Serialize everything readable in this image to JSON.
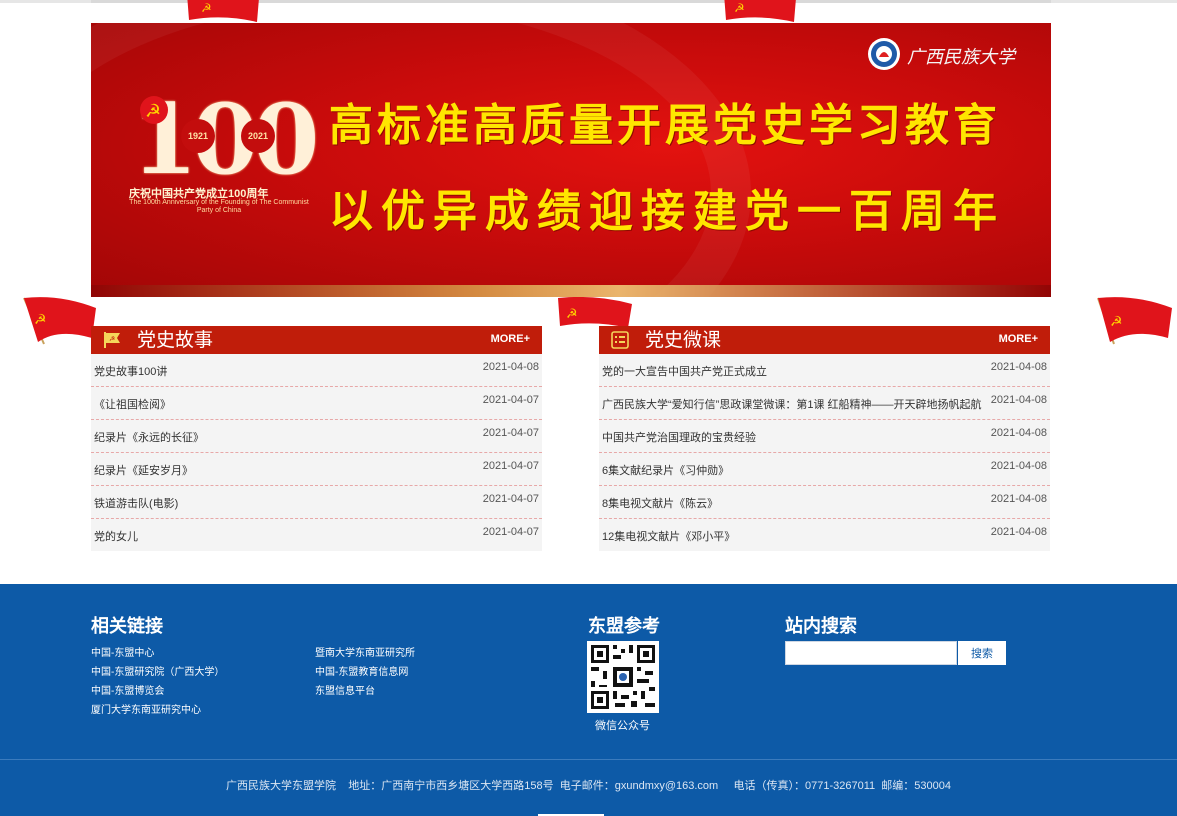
{
  "banner": {
    "slogan_line1": "高标准高质量开展党史学习教育",
    "slogan_line2": "以优异成绩迎接建党一百周年",
    "emblem_number": "100",
    "emblem_year_start": "1921",
    "emblem_year_end": "2021",
    "emblem_cn": "庆祝中国共产党成立100周年",
    "emblem_en": "The 100th Anniversary of the Founding of The Communist Party of China",
    "university_name": "广西民族大学"
  },
  "stories": {
    "title": "党史故事",
    "more": "MORE+",
    "items": [
      {
        "title": "党史故事100讲",
        "date": "2021-04-08"
      },
      {
        "title": "《让祖国检阅》",
        "date": "2021-04-07"
      },
      {
        "title": "纪录片《永远的长征》",
        "date": "2021-04-07"
      },
      {
        "title": "纪录片《延安岁月》",
        "date": "2021-04-07"
      },
      {
        "title": "铁道游击队(电影)",
        "date": "2021-04-07"
      },
      {
        "title": "党的女儿",
        "date": "2021-04-07"
      }
    ]
  },
  "microlessons": {
    "title": "党史微课",
    "more": "MORE+",
    "items": [
      {
        "title": "党的一大宣告中国共产党正式成立",
        "date": "2021-04-08"
      },
      {
        "title": "广西民族大学“爱知行信”思政课堂微课：第1课 红船精神——开天辟地扬帆起航",
        "date": "2021-04-08"
      },
      {
        "title": "中国共产党治国理政的宝贵经验",
        "date": "2021-04-08"
      },
      {
        "title": "6集文献纪录片《习仲勋》",
        "date": "2021-04-08"
      },
      {
        "title": "8集电视文献片《陈云》",
        "date": "2021-04-08"
      },
      {
        "title": "12集电视文献片《邓小平》",
        "date": "2021-04-08"
      }
    ]
  },
  "footer": {
    "links_title": "相关链接",
    "links_col1": [
      "中国-东盟中心",
      "中国-东盟研究院（广西大学）",
      "中国-东盟博览会",
      "厦门大学东南亚研究中心"
    ],
    "links_col2": [
      "暨南大学东南亚研究所",
      "中国-东盟教育信息网",
      "东盟信息平台"
    ],
    "reference_title": "东盟参考",
    "qr_caption": "微信公众号",
    "search_title": "站内搜索",
    "search_button": "搜索",
    "search_value": "",
    "copyright": "广西民族大学东盟学院    地址：广西南宁市西乡塘区大学西路158号  电子邮件：gxundmxy@163.com     电话（传真）：0771-3267011  邮编：530004"
  },
  "colors": {
    "header_red": "#c01d0a",
    "footer_blue": "#0d5aa7",
    "slogan_yellow": "#ffe600"
  }
}
